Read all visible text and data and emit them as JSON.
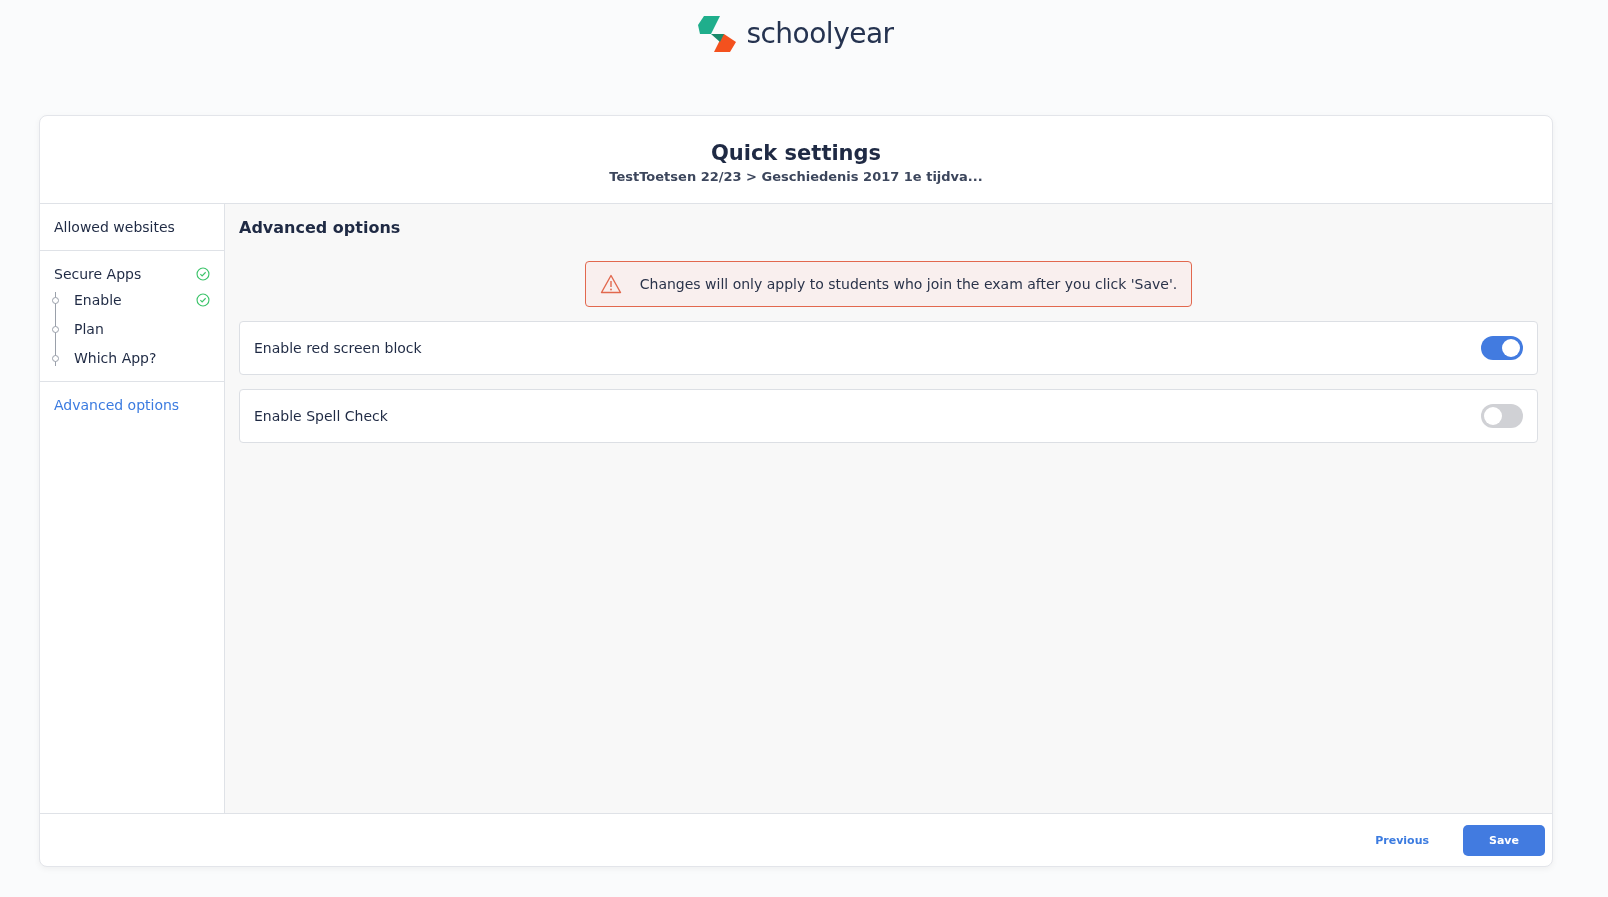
{
  "brand": {
    "name": "schoolyear"
  },
  "header": {
    "title": "Quick settings",
    "subtitle": "TestToetsen 22/23 > Geschiedenis 2017 1e tijdva..."
  },
  "sidebar": {
    "sections": [
      {
        "label": "Allowed websites",
        "selected": false,
        "done": false
      },
      {
        "label": "Secure Apps",
        "selected": false,
        "done": true,
        "children": [
          {
            "label": "Enable",
            "selected": false,
            "done": true
          },
          {
            "label": "Plan",
            "selected": false,
            "done": false
          },
          {
            "label": "Which App?",
            "selected": false,
            "done": false
          }
        ]
      },
      {
        "label": "Advanced options",
        "selected": true,
        "done": false
      }
    ]
  },
  "content": {
    "title": "Advanced options",
    "warning": "Changes will only apply to students who join the exam after you click 'Save'.",
    "options": [
      {
        "label": "Enable red screen block",
        "on": true
      },
      {
        "label": "Enable Spell Check",
        "on": false
      }
    ]
  },
  "footer": {
    "buttons": [
      {
        "label": "Previous",
        "kind": "link"
      },
      {
        "label": "Save",
        "kind": "primary"
      }
    ]
  }
}
